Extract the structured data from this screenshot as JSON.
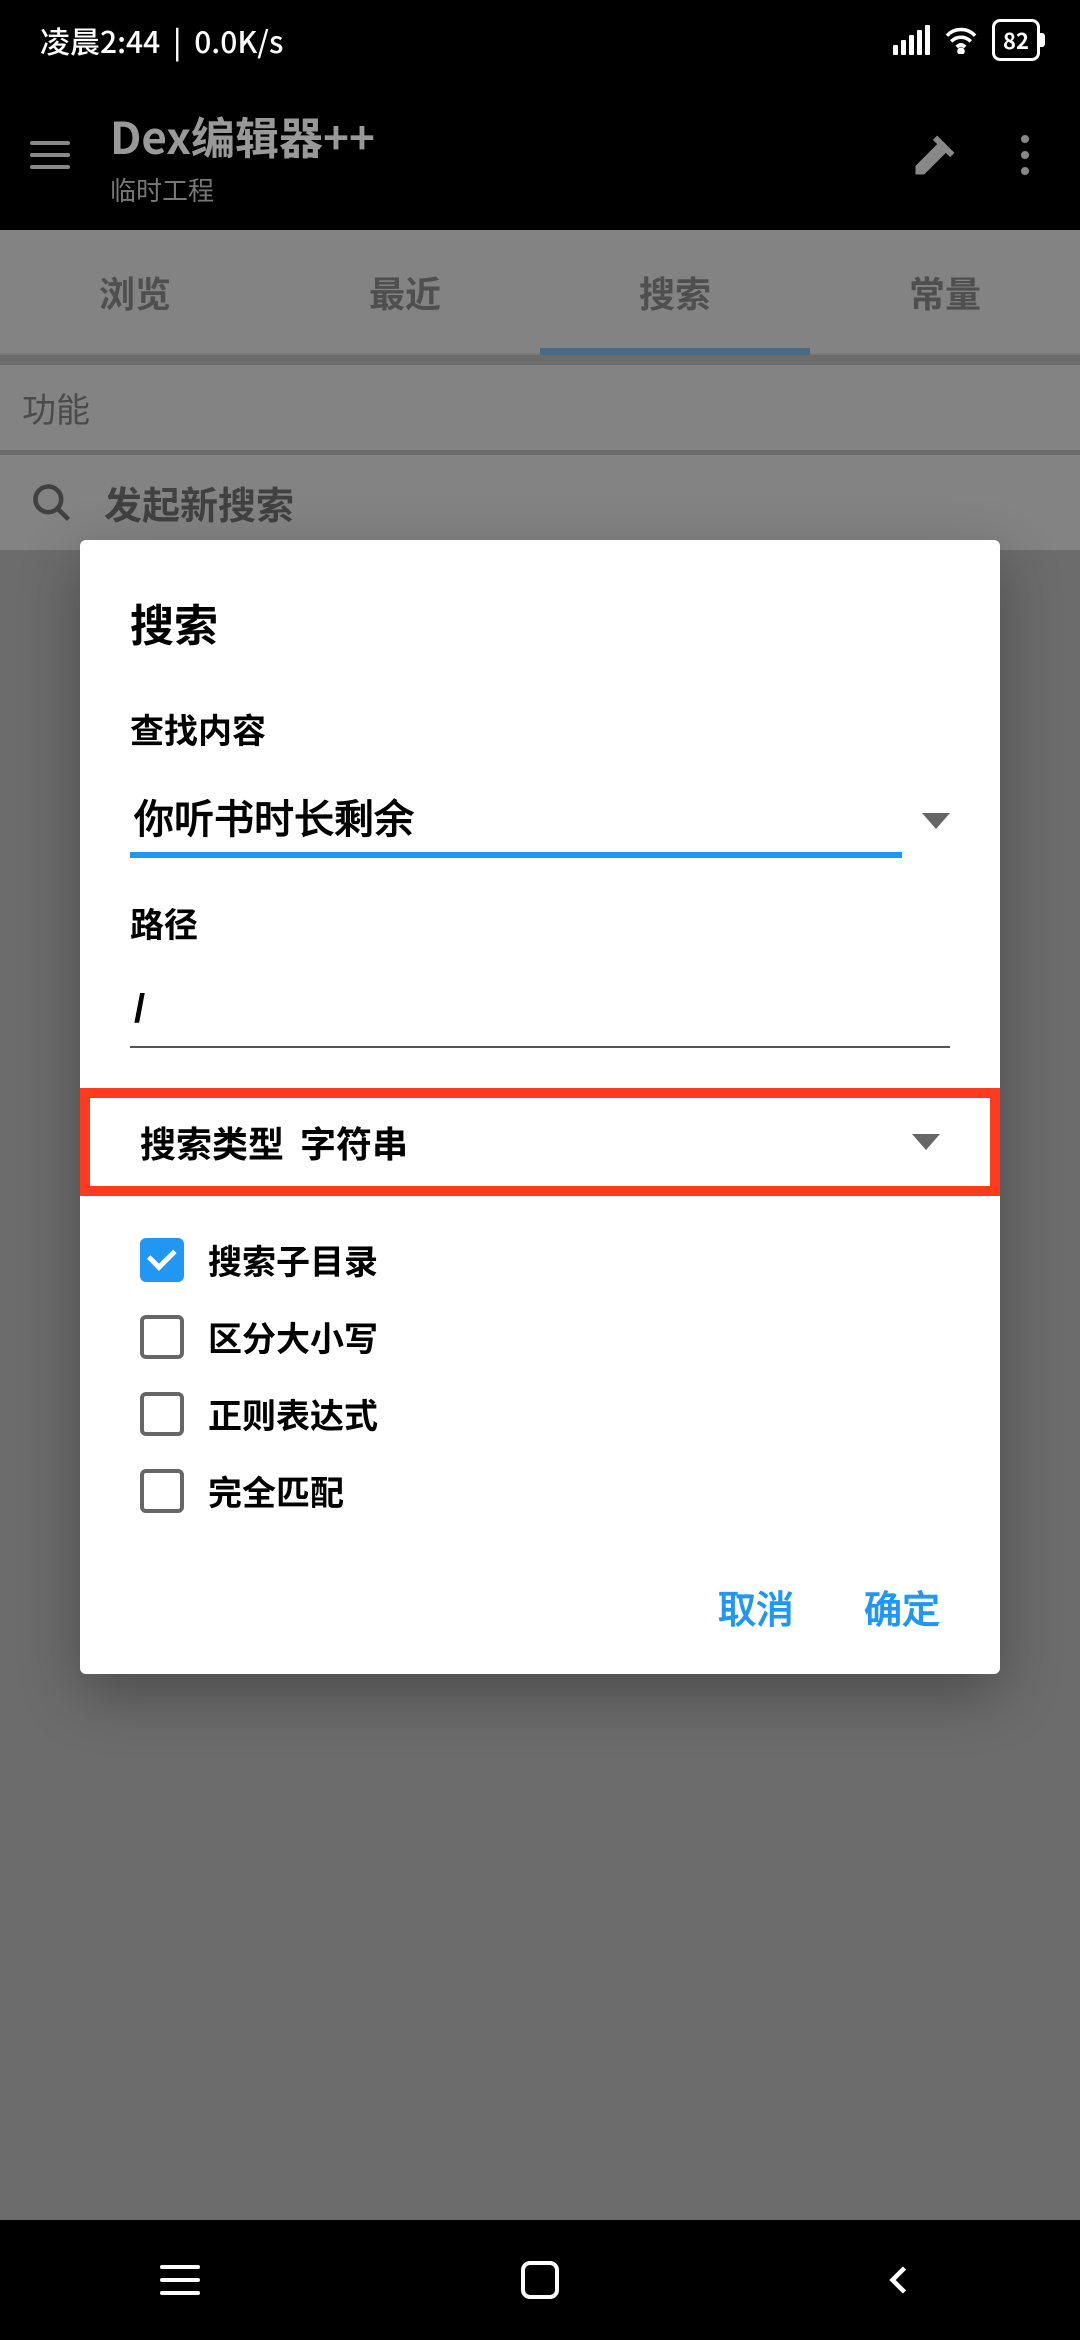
{
  "status": {
    "time_label": "凌晨2:44",
    "net_speed": "0.0K/s",
    "battery": "82"
  },
  "appbar": {
    "title": "Dex编辑器++",
    "subtitle": "临时工程"
  },
  "tabs": {
    "browse": "浏览",
    "recent": "最近",
    "search": "搜索",
    "constants": "常量"
  },
  "section": {
    "heading": "功能",
    "new_search": "发起新搜索"
  },
  "dialog": {
    "title": "搜索",
    "query_label": "查找内容",
    "query_value": "你听书时长剩余",
    "path_label": "路径",
    "path_value": "/",
    "type_label": "搜索类型",
    "type_value": "字符串",
    "options": {
      "sub_dirs": "搜索子目录",
      "case_sensitive": "区分大小写",
      "regex": "正则表达式",
      "whole": "完全匹配"
    },
    "cancel": "取消",
    "confirm": "确定"
  }
}
